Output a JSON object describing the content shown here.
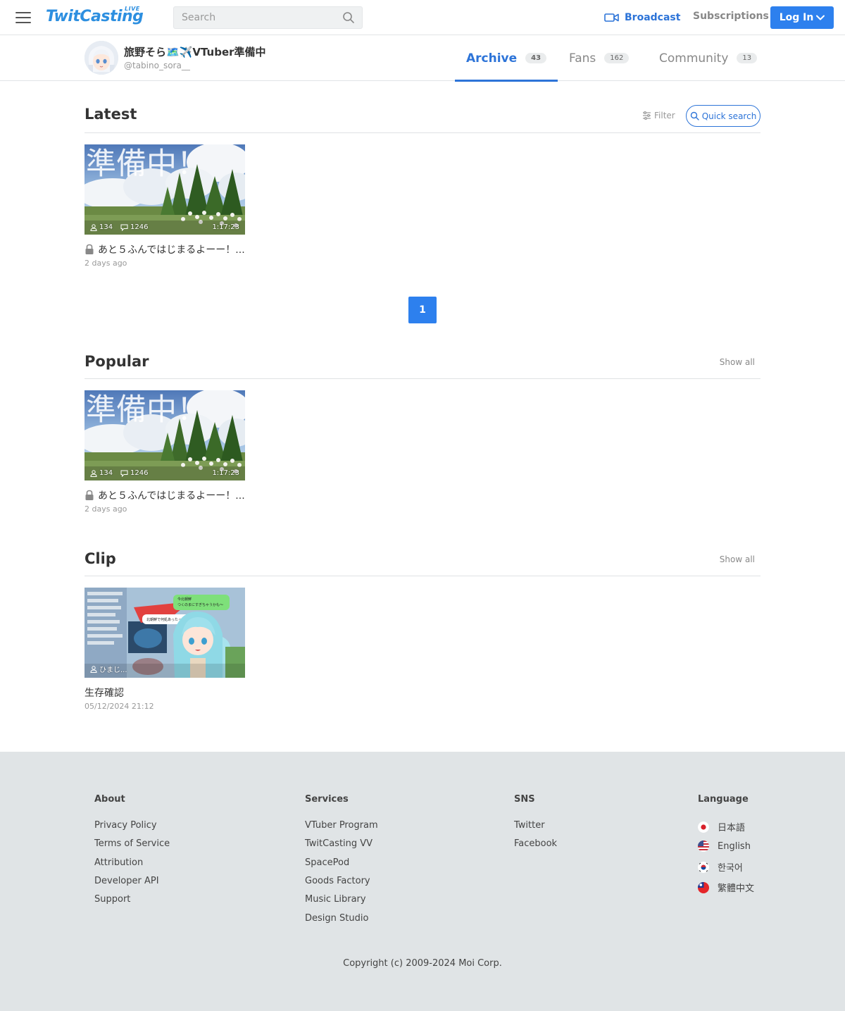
{
  "header": {
    "logo": "TwitCasting",
    "logo_badge": "LIVE",
    "search_placeholder": "Search",
    "broadcast": "Broadcast",
    "subscriptions": "Subscriptions",
    "login": "Log In"
  },
  "profile": {
    "name": "旅野そら🗺️✈️VTuber準備中",
    "handle": "@tabino_sora__",
    "tabs": [
      {
        "label": "Archive",
        "count": "43",
        "active": true
      },
      {
        "label": "Fans",
        "count": "162"
      },
      {
        "label": "Community",
        "count": "13"
      }
    ]
  },
  "latest": {
    "title": "Latest",
    "filter": "Filter",
    "quick_search": "Quick search",
    "video": {
      "thumb_text": "準備中！",
      "viewers": "134",
      "comments": "1246",
      "duration": "1:17:23",
      "title": "あと５ふんではじまるよーー！...",
      "date": "2 days ago"
    },
    "page": "1"
  },
  "popular": {
    "title": "Popular",
    "show_all": "Show all",
    "video": {
      "thumb_text": "準備中！",
      "viewers": "134",
      "comments": "1246",
      "duration": "1:17:23",
      "title": "あと５ふんではじまるよーー！...",
      "date": "2 days ago"
    }
  },
  "clip": {
    "title": "Clip",
    "show_all": "Show all",
    "video": {
      "bubble1": "今北朝鮮",
      "bubble1b": "つくのまにすぎちゃうかも〜",
      "bubble2": "北朝鮮で何処あったっけ？",
      "user": "ひまじ...",
      "title": "生存確認",
      "date": "05/12/2024 21:12"
    }
  },
  "footer": {
    "about": {
      "heading": "About",
      "links": [
        "Privacy Policy",
        "Terms of Service",
        "Attribution",
        "Developer API",
        "Support"
      ]
    },
    "services": {
      "heading": "Services",
      "links": [
        "VTuber Program",
        "TwitCasting VV",
        "SpacePod",
        "Goods Factory",
        "Music Library",
        "Design Studio"
      ]
    },
    "sns": {
      "heading": "SNS",
      "links": [
        "Twitter",
        "Facebook"
      ]
    },
    "language": {
      "heading": "Language",
      "links": [
        "日本語",
        "English",
        "한국어",
        "繁體中文"
      ]
    },
    "copyright": "Copyright (c) 2009-2024 Moi Corp."
  },
  "colors": {
    "accent": "#2d74d8",
    "button": "#2d80ee",
    "footer_bg": "#e0e4e6"
  }
}
